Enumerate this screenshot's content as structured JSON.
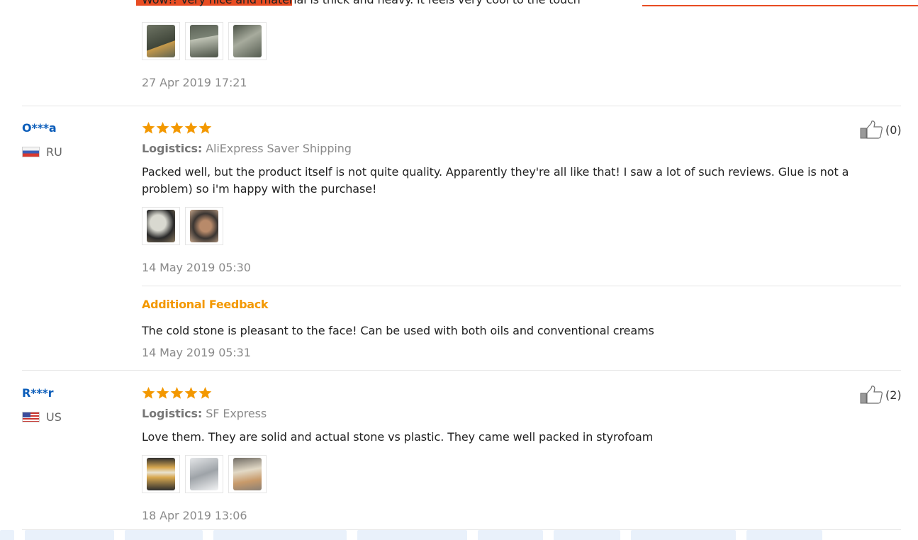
{
  "top_review": {
    "text_cut": "Wow!! Very nice and material is thick and heavy. It feels very cool to the touch",
    "photos": [
      "photo-1",
      "photo-2",
      "photo-3"
    ],
    "date": "27 Apr 2019 17:21"
  },
  "reviews": [
    {
      "user": "O***a",
      "country": "RU",
      "rating": 5,
      "logistics_label": "Logistics:",
      "logistics_value": "AliExpress Saver Shipping",
      "text": "Packed well, but the product itself is not quite quality. Apparently they're all like that! I saw a lot of such reviews. Glue is not a problem) so i'm happy with the purchase!",
      "photos": [
        "photo-1",
        "photo-2"
      ],
      "date": "14 May 2019 05:30",
      "helpful_count": "(0)",
      "additional": {
        "title": "Additional Feedback",
        "text": "The cold stone is pleasant to the face! Can be used with both oils and conventional creams",
        "date": "14 May 2019 05:31"
      }
    },
    {
      "user": "R***r",
      "country": "US",
      "rating": 5,
      "logistics_label": "Logistics:",
      "logistics_value": "SF Express",
      "text": "Love them. They are solid and actual stone vs plastic. They came well packed in styrofoam",
      "photos": [
        "photo-1",
        "photo-2",
        "photo-3"
      ],
      "date": "18 Apr 2019 13:06",
      "helpful_count": "(2)"
    }
  ],
  "icons": {
    "star": "star-icon",
    "thumb": "thumbs-up-icon",
    "flag_ru": "flag-ru-icon",
    "flag_us": "flag-us-icon"
  },
  "colors": {
    "accent": "#e84c22",
    "star": "#f39800",
    "username": "#0b5dba",
    "additional_title": "#f39800"
  }
}
